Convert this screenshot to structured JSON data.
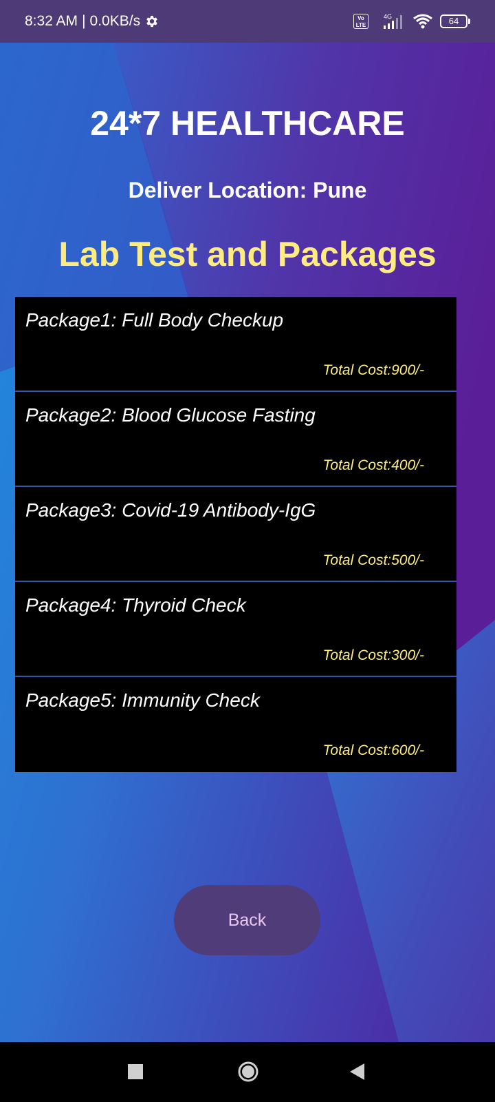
{
  "status_bar": {
    "time": "8:32 AM",
    "separator": "|",
    "network_speed": "0.0KB/s",
    "settings_icon": "gear-icon",
    "volte_label": "Vo LTE",
    "network_type": "4G",
    "battery_level": "64"
  },
  "header": {
    "app_title": "24*7 HEALTHCARE",
    "location_text": "Deliver Location: Pune"
  },
  "main": {
    "section_title": "Lab Test and Packages",
    "packages": [
      {
        "name": "Package1: Full Body Checkup",
        "cost": "Total Cost:900/-"
      },
      {
        "name": "Package2: Blood Glucose Fasting",
        "cost": "Total Cost:400/-"
      },
      {
        "name": "Package3: Covid-19 Antibody-IgG",
        "cost": "Total Cost:500/-"
      },
      {
        "name": "Package4: Thyroid Check",
        "cost": "Total Cost:300/-"
      },
      {
        "name": "Package5: Immunity Check",
        "cost": "Total Cost:600/-"
      }
    ],
    "back_label": "Back"
  },
  "nav_bar": {
    "recent_icon": "square-recents-icon",
    "home_icon": "circle-home-icon",
    "back_icon": "triangle-back-icon"
  },
  "colors": {
    "accent_yellow": "#ffec80",
    "status_bar_bg": "#4e3a76",
    "button_bg": "#4f3c78",
    "button_text": "#e8c7ef",
    "list_bg": "#000000"
  }
}
